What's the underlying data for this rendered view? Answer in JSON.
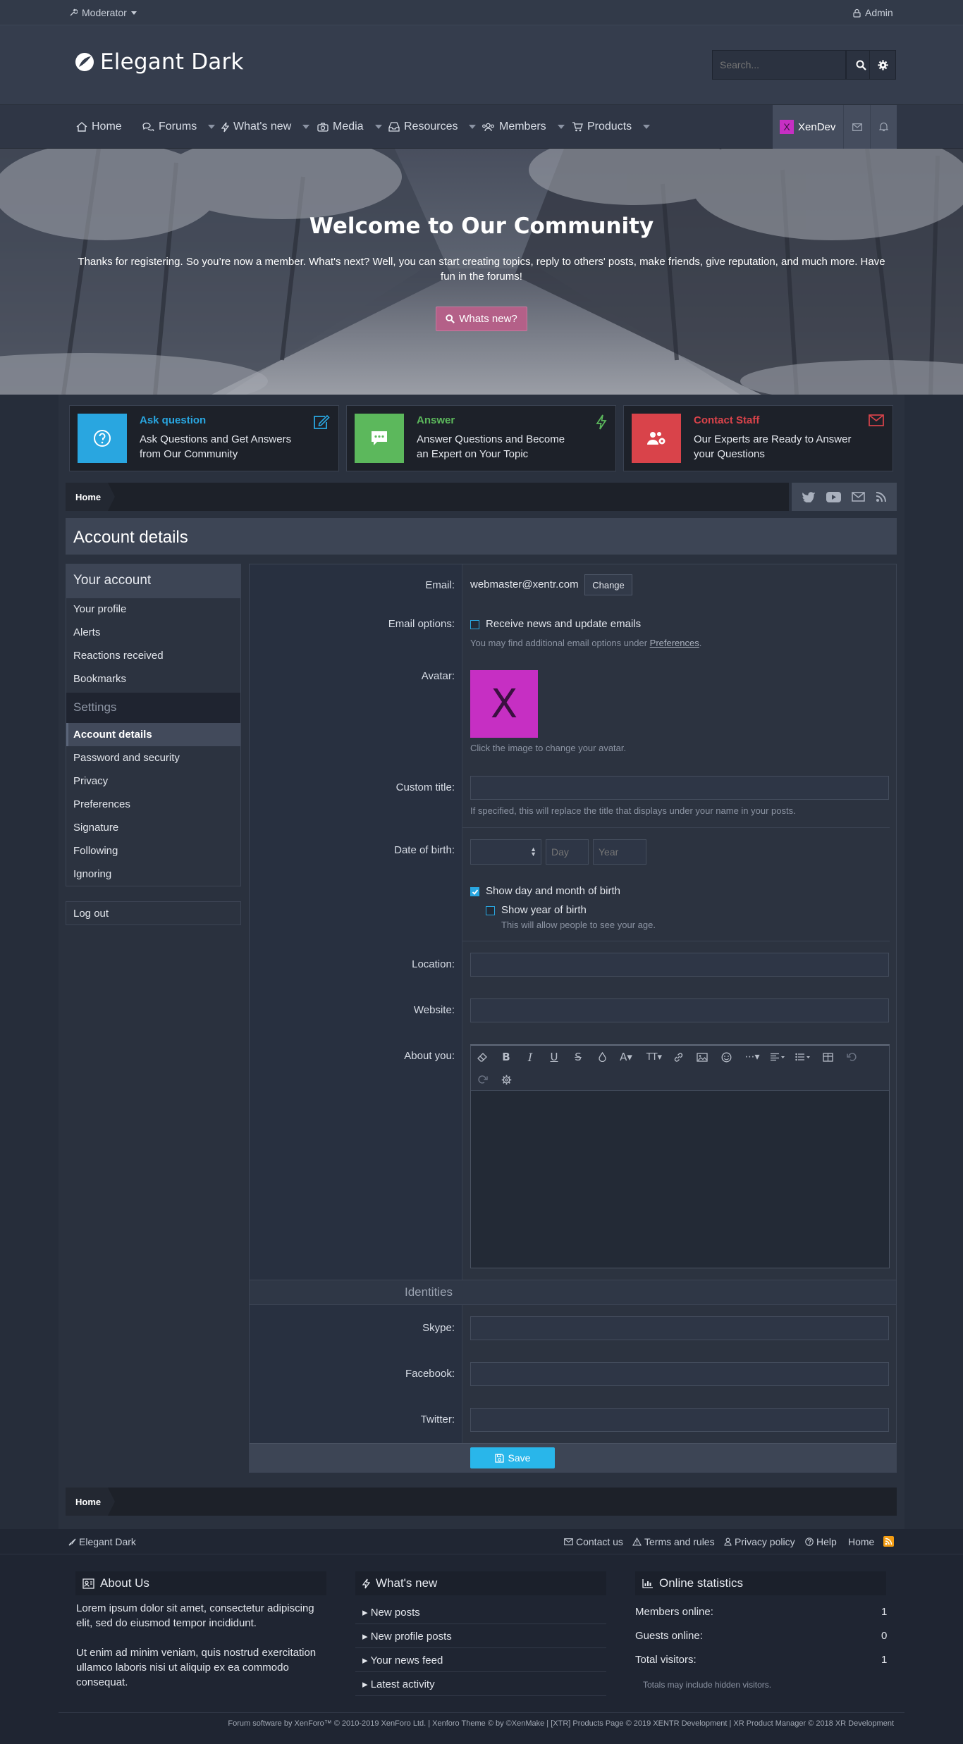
{
  "topbar": {
    "moderator": "Moderator",
    "admin": "Admin"
  },
  "header": {
    "logo": "Elegant Dark",
    "search_placeholder": "Search..."
  },
  "nav": {
    "items": [
      {
        "label": "Home"
      },
      {
        "label": "Forums"
      },
      {
        "label": "What's new"
      },
      {
        "label": "Media"
      },
      {
        "label": "Resources"
      },
      {
        "label": "Members"
      },
      {
        "label": "Products"
      }
    ],
    "user": {
      "initial": "X",
      "name": "XenDev"
    }
  },
  "hero": {
    "title": "Welcome to Our Community",
    "text": "Thanks for registering. So you’re now a member. What's next? Well, you can start creating topics, reply to others' posts, make friends, give reputation, and much more. Have fun in the forums!",
    "button": "Whats new?"
  },
  "features": [
    {
      "title": "Ask question",
      "desc": "Ask Questions and Get Answers from Our Community",
      "color": "#29a6e0"
    },
    {
      "title": "Answer",
      "desc": "Answer Questions and Become an Expert on Your Topic",
      "color": "#5cb85c"
    },
    {
      "title": "Contact Staff",
      "desc": "Our Experts are Ready to Answer your Questions",
      "color": "#d9434a"
    }
  ],
  "breadcrumb": {
    "home": "Home"
  },
  "page": {
    "title": "Account details"
  },
  "sidebar": {
    "account_head": "Your account",
    "account_items": [
      "Your profile",
      "Alerts",
      "Reactions received",
      "Bookmarks"
    ],
    "settings_head": "Settings",
    "settings_items": [
      "Account details",
      "Password and security",
      "Privacy",
      "Preferences",
      "Signature",
      "Following",
      "Ignoring"
    ],
    "logout": "Log out"
  },
  "form": {
    "email_label": "Email:",
    "email_value": "webmaster@xentr.com",
    "change": "Change",
    "email_options_label": "Email options:",
    "receive_news": "Receive news and update emails",
    "email_hint": "You may find additional email options under",
    "preferences": "Preferences",
    "avatar_label": "Avatar:",
    "avatar_letter": "X",
    "avatar_hint": "Click the image to change your avatar.",
    "custom_title_label": "Custom title:",
    "custom_title_hint": "If specified, this will replace the title that displays under your name in your posts.",
    "dob_label": "Date of birth:",
    "day_placeholder": "Day",
    "year_placeholder": "Year",
    "show_day_month": "Show day and month of birth",
    "show_year": "Show year of birth",
    "show_year_hint": "This will allow people to see your age.",
    "location_label": "Location:",
    "website_label": "Website:",
    "about_label": "About you:",
    "identities": "Identities",
    "skype_label": "Skype:",
    "facebook_label": "Facebook:",
    "twitter_label": "Twitter:",
    "save": "Save"
  },
  "footer": {
    "brand": "Elegant Dark",
    "links": [
      "Contact us",
      "Terms and rules",
      "Privacy policy",
      "Help",
      "Home"
    ],
    "about_head": "About Us",
    "about_p1": "Lorem ipsum dolor sit amet, consectetur adipiscing elit, sed do eiusmod tempor incididunt.",
    "about_p2": "Ut enim ad minim veniam, quis nostrud exercitation ullamco laboris nisi ut aliquip ex ea commodo consequat.",
    "whatsnew_head": "What's new",
    "whatsnew_items": [
      "New posts",
      "New profile posts",
      "Your news feed",
      "Latest activity"
    ],
    "stats_head": "Online statistics",
    "stats": [
      {
        "label": "Members online:",
        "value": "1"
      },
      {
        "label": "Guests online:",
        "value": "0"
      },
      {
        "label": "Total visitors:",
        "value": "1"
      }
    ],
    "stats_note": "Totals may include hidden visitors.",
    "copyright": "Forum software by XenForo™ © 2010-2019 XenForo Ltd. | Xenforo Theme © by ©XenMake | [XTR] Products Page © 2019 XENTR Development | XR Product Manager © 2018 XR Development"
  }
}
